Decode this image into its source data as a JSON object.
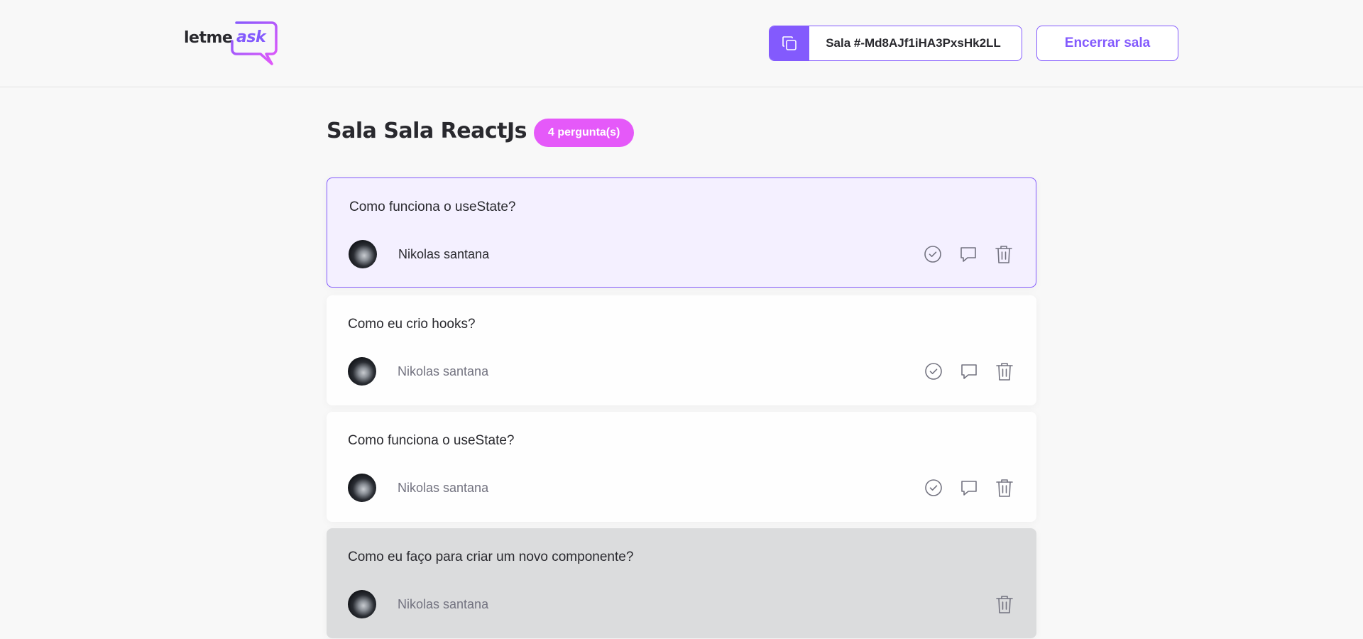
{
  "header": {
    "logo_text": "letme",
    "logo_accent": "ask",
    "room_code_label": "Sala #-Md8AJf1iHA3PxsHk2LL",
    "close_room_label": "Encerrar sala",
    "copy_icon": "copy-icon"
  },
  "room": {
    "title": "Sala Sala ReactJs",
    "question_count": "4 pergunta(s)"
  },
  "questions": [
    {
      "text": "Como funciona o useState?",
      "author": "Nikolas santana",
      "state": "highlighted"
    },
    {
      "text": "Como eu crio hooks?",
      "author": "Nikolas santana",
      "state": "normal"
    },
    {
      "text": "Como funciona o useState?",
      "author": "Nikolas santana",
      "state": "normal"
    },
    {
      "text": "Como eu faço para criar um novo componente?",
      "author": "Nikolas santana",
      "state": "answered"
    }
  ],
  "icons": {
    "check": "check-circle-icon",
    "answer": "chat-bubble-icon",
    "delete": "trash-icon"
  },
  "colors": {
    "accent": "#835afd",
    "badge": "#e559f9",
    "highlighted_bg": "#f4f0ff",
    "answered_bg": "#dbdcdd",
    "icon_gray": "#737380"
  }
}
